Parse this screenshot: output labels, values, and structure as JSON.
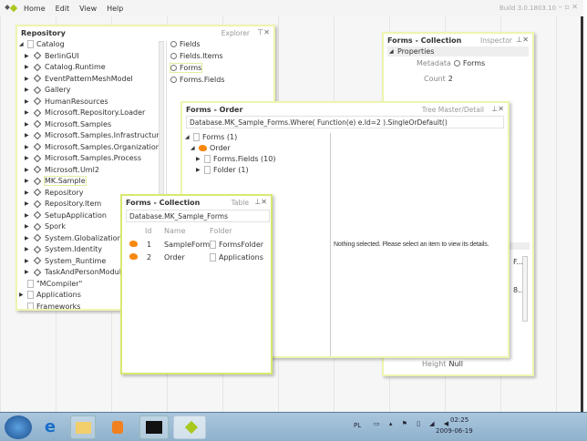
{
  "menu": {
    "items": [
      "Home",
      "Edit",
      "View",
      "Help"
    ],
    "build": "Build 3.0.1803.10"
  },
  "repository": {
    "title": "Repository",
    "view": "Explorer",
    "tree": [
      "Catalog",
      "BerlinGUI",
      "Catalog.Runtime",
      "EventPatternMeshModel",
      "Gallery",
      "HumanResources",
      "Microsoft.Repository.Loader",
      "Microsoft.Samples",
      "Microsoft.Samples.Infrastructure",
      "Microsoft.Samples.Organization",
      "Microsoft.Samples.Process",
      "Microsoft.Uml2",
      "MK.Sample",
      "Repository",
      "Repository.Item",
      "SetupApplication",
      "Spork",
      "System.Globalization",
      "System.Identity",
      "System_Runtime",
      "TaskAndPersonModule",
      "\"MCompiler\"",
      "Applications",
      "Frameworks"
    ],
    "list": [
      "Fields",
      "Fields.Items",
      "Forms",
      "Forms.Fields"
    ]
  },
  "inspector": {
    "title": "Forms - Collection",
    "view": "Inspector",
    "section": "Properties",
    "metadata_label": "Metadata",
    "metadata_value": "Forms",
    "count_label": "Count",
    "count_value": "2",
    "height_label": "Height",
    "height_value": "Null",
    "trunc1": "F...",
    "trunc2": "8..."
  },
  "order": {
    "title": "Forms - Order",
    "view": "Tree Master/Detail",
    "query": "Database.MK_Sample_Forms.Where( Function(e) e.Id=2 ).SingleOrDefault()",
    "tree": [
      "Forms  (1)",
      "Order",
      "Forms.Fields  (10)",
      "Folder  (1)"
    ],
    "empty": "Nothing selected. Please select an item to view its details."
  },
  "table": {
    "title": "Forms - Collection",
    "view": "Table",
    "query": "Database.MK_Sample_Forms",
    "columns": [
      "Id",
      "Name",
      "Folder"
    ],
    "rows": [
      {
        "id": "1",
        "name": "SampleForm",
        "folder": "FormsFolder"
      },
      {
        "id": "2",
        "name": "Order",
        "folder": "Applications"
      }
    ]
  },
  "taskbar": {
    "lang": "PL",
    "time": "02:25",
    "date": "2009-06-19"
  },
  "colors": {
    "accent": "#eef4b0",
    "brand_green": "#a8c81e",
    "bird": "#f7880f"
  }
}
